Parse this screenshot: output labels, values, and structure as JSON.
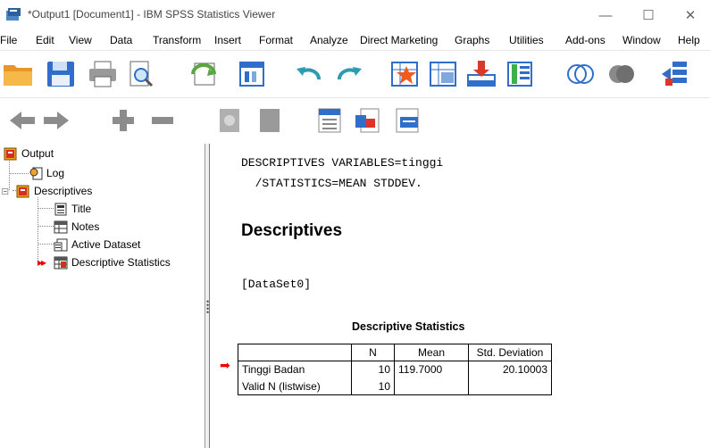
{
  "window": {
    "title": "*Output1 [Document1] - IBM SPSS Statistics Viewer",
    "minimize_glyph": "—",
    "maximize_glyph": "☐",
    "close_glyph": "✕"
  },
  "menu": {
    "items": [
      "File",
      "Edit",
      "View",
      "Data",
      "Transform",
      "Insert",
      "Format",
      "Analyze",
      "Direct Marketing",
      "Graphs",
      "Utilities",
      "Add-ons",
      "Window",
      "Help"
    ]
  },
  "toolbar1": {
    "icons": [
      "open-folder-icon",
      "save-icon",
      "print-icon",
      "print-preview-icon",
      "export-icon",
      "recall-dialog-icon",
      "undo-icon",
      "redo-icon",
      "goto-data-icon",
      "goto-variable-icon",
      "goto-case-icon",
      "insert-variable-icon",
      "insert-case-icon",
      "show-hide-icon",
      "script-icon"
    ]
  },
  "toolbar2": {
    "icons": [
      "back-icon",
      "forward-icon",
      "expand-icon",
      "collapse-icon",
      "show-icon",
      "hide-icon",
      "insert-heading-icon",
      "insert-title-icon",
      "insert-text-icon"
    ]
  },
  "tree": {
    "output": "Output",
    "log": "Log",
    "descriptives": "Descriptives",
    "title": "Title",
    "notes": "Notes",
    "active_dataset": "Active Dataset",
    "descriptive_statistics": "Descriptive Statistics"
  },
  "content": {
    "syntax_line1": "DESCRIPTIVES VARIABLES=tinggi",
    "syntax_line2": "  /STATISTICS=MEAN STDDEV.",
    "heading": "Descriptives",
    "dataset": "[DataSet0]",
    "table_title": "Descriptive Statistics",
    "table": {
      "headers": [
        "",
        "N",
        "Mean",
        "Std. Deviation"
      ],
      "rows": [
        [
          "Tinggi Badan",
          "10",
          "119.7000",
          "20.10003"
        ],
        [
          "Valid N (listwise)",
          "10",
          "",
          ""
        ]
      ]
    }
  },
  "colors": {
    "accent_red": "#e00000",
    "toolbar_blue": "#2f6fc9",
    "folder_orange": "#f0a32a"
  }
}
